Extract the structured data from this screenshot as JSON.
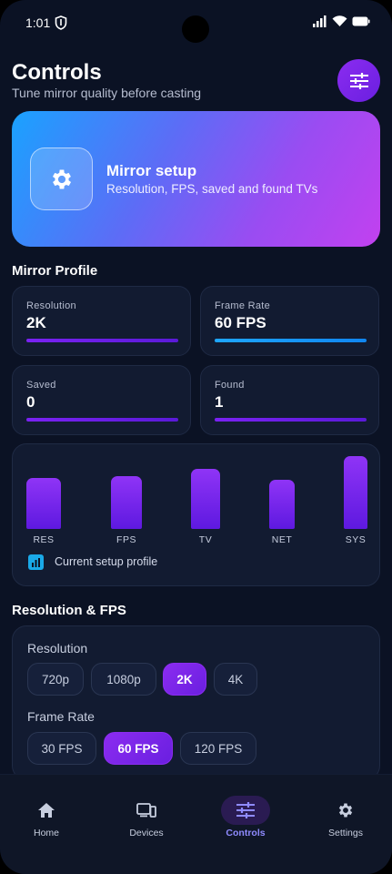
{
  "status_bar": {
    "time": "1:01"
  },
  "header": {
    "title": "Controls",
    "subtitle": "Tune mirror quality before casting"
  },
  "hero": {
    "title": "Mirror setup",
    "subtitle": "Resolution, FPS, saved and found TVs"
  },
  "mirror_profile": {
    "title": "Mirror Profile",
    "stats": [
      {
        "label": "Resolution",
        "value": "2K"
      },
      {
        "label": "Frame Rate",
        "value": "60 FPS"
      },
      {
        "label": "Saved",
        "value": "0"
      },
      {
        "label": "Found",
        "value": "1"
      }
    ]
  },
  "chart_data": {
    "type": "bar",
    "categories": [
      "RES",
      "FPS",
      "TV",
      "NET",
      "SYS"
    ],
    "values": [
      0.7,
      0.73,
      0.83,
      0.68,
      1.0
    ],
    "legend": "Current setup profile"
  },
  "resolution_fps": {
    "title": "Resolution & FPS",
    "resolution_label": "Resolution",
    "resolutions": [
      "720p",
      "1080p",
      "2K",
      "4K"
    ],
    "selected_resolution": "2K",
    "frame_rate_label": "Frame Rate",
    "frame_rates": [
      "30 FPS",
      "60 FPS",
      "120 FPS"
    ],
    "selected_frame_rate": "60 FPS"
  },
  "nav": {
    "items": [
      {
        "label": "Home",
        "icon": "home-icon"
      },
      {
        "label": "Devices",
        "icon": "devices-icon"
      },
      {
        "label": "Controls",
        "icon": "sliders-icon"
      },
      {
        "label": "Settings",
        "icon": "gear-icon"
      }
    ],
    "active": "Controls"
  },
  "colors": {
    "accent": "#7a22f2",
    "accent_blue": "#1ea6ff",
    "background": "#0b1224",
    "card": "#121b31"
  }
}
